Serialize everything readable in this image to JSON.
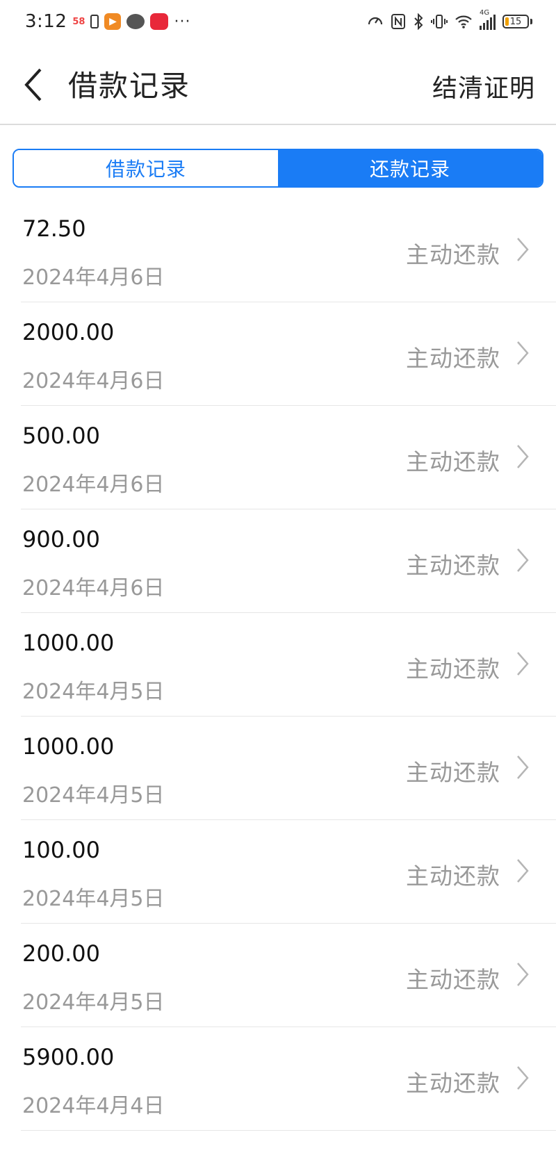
{
  "status_bar": {
    "time": "3:12",
    "app_58": "58",
    "more": "···",
    "network": "4G",
    "battery_level": "15",
    "battery_color": "#f0a000"
  },
  "header": {
    "title": "借款记录",
    "right_action": "结清证明"
  },
  "tabs": [
    {
      "label": "借款记录",
      "active": false
    },
    {
      "label": "还款记录",
      "active": true
    }
  ],
  "accent_color": "#1a7cf5",
  "records": [
    {
      "amount": "72.50",
      "date": "2024年4月6日",
      "type": "主动还款"
    },
    {
      "amount": "2000.00",
      "date": "2024年4月6日",
      "type": "主动还款"
    },
    {
      "amount": "500.00",
      "date": "2024年4月6日",
      "type": "主动还款"
    },
    {
      "amount": "900.00",
      "date": "2024年4月6日",
      "type": "主动还款"
    },
    {
      "amount": "1000.00",
      "date": "2024年4月5日",
      "type": "主动还款"
    },
    {
      "amount": "1000.00",
      "date": "2024年4月5日",
      "type": "主动还款"
    },
    {
      "amount": "100.00",
      "date": "2024年4月5日",
      "type": "主动还款"
    },
    {
      "amount": "200.00",
      "date": "2024年4月5日",
      "type": "主动还款"
    },
    {
      "amount": "5900.00",
      "date": "2024年4月4日",
      "type": "主动还款"
    }
  ]
}
